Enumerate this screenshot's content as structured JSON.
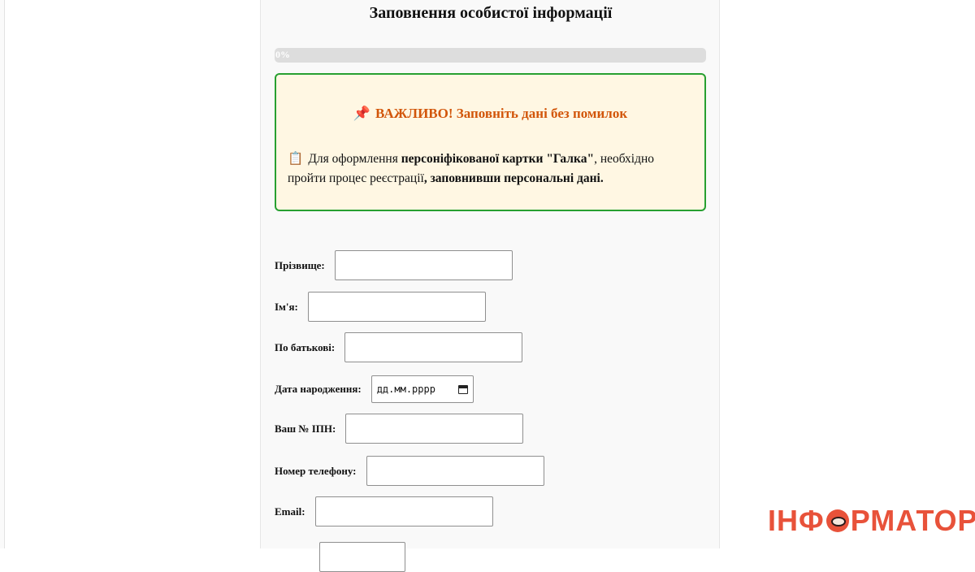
{
  "page": {
    "title": "Заповнення особистої інформації"
  },
  "progress": {
    "value_percent": 0,
    "label": "0%"
  },
  "notice": {
    "pin_icon": "📌",
    "title": "ВАЖЛИВО! Заповніть дані без помилок",
    "clipboard_icon": "📋",
    "text_1": "Для оформлення ",
    "bold_1": "персоніфікованої картки \"Галка\"",
    "text_2": ", необхідно пройти процес реєстрації",
    "bold_2": ", заповнивши персональні дані."
  },
  "form": {
    "surname_label": "Прізвище:",
    "surname_value": "",
    "name_label": "Ім'я:",
    "name_value": "",
    "patronymic_label": "По батькові:",
    "patronymic_value": "",
    "birthdate_label": "Дата народження:",
    "birthdate_placeholder": "дд.мм.рррр",
    "tax_id_label": "Ваш № ІПН:",
    "tax_id_value": "",
    "phone_label": "Номер телефону:",
    "phone_value": "",
    "email_label": "Email:",
    "email_value": ""
  },
  "watermark": {
    "logo_part_1": "ІНФ",
    "logo_part_2": "РМАТОР"
  },
  "colors": {
    "notice_border": "#28a031",
    "notice_background": "#fff7e3",
    "notice_title": "#d2560a",
    "logo": "#e8523a"
  }
}
